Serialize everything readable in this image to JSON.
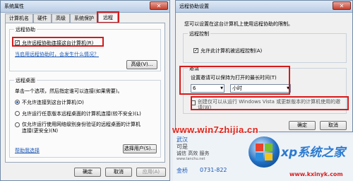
{
  "left_window": {
    "title": "系统属性",
    "tabs": [
      "计算机名",
      "硬件",
      "高级",
      "系统保护",
      "远程"
    ],
    "remote_assistance": {
      "group_title": "远程协助",
      "allow_checkbox_label": "允许远程协助连接这台计算机(R)",
      "help_link": "当启用远程协助时，会发生什么情况？",
      "advanced_button": "高级(V)..."
    },
    "remote_desktop": {
      "group_title": "远程桌面",
      "instruction": "单击一个选项，然后指定谁可以连接(如果需要)。",
      "options": [
        "不允许连接到这台计算机(D)",
        "允许运行任意版本远程桌面的计算机连接(较不安全)(L)",
        "仅允许运行使用网络级别身份验证的远程桌面的计算机连接(更安全)(N)"
      ],
      "help_link": "帮助我选择",
      "select_users_button": "选择用户(S)..."
    },
    "buttons": {
      "ok": "确定",
      "cancel": "取消",
      "apply": "应用(A)"
    }
  },
  "right_window": {
    "title": "远程协助设置",
    "description": "您可以设置在这台计算机上使用远程协助的限制。",
    "remote_control": {
      "group_title": "远程控制",
      "allow_control_label": "允许此计算机被远程控制(A)"
    },
    "invitations": {
      "group_title": "邀请",
      "prompt": "设置邀请可以保持为打开的最长时间(T)",
      "value": "6",
      "unit": "小时",
      "vista_checkbox_label": "创建仅可以从运行 Windows Vista 或更新版本的计算机使用的邀请(W)"
    },
    "buttons": {
      "ok": "确定",
      "cancel": "取消"
    }
  },
  "watermark": {
    "site": "www.win7zhijia.cn",
    "ad_line1": "武汉",
    "ad_line2": "可是",
    "ad_line3": "诚信 高效 服务",
    "ad_small": "www.tanchu.net",
    "phone_prefix": "金桥",
    "phone": "0731-822",
    "logo_text": "xp系统之家",
    "logo_url": "www.kxinyk.com"
  }
}
